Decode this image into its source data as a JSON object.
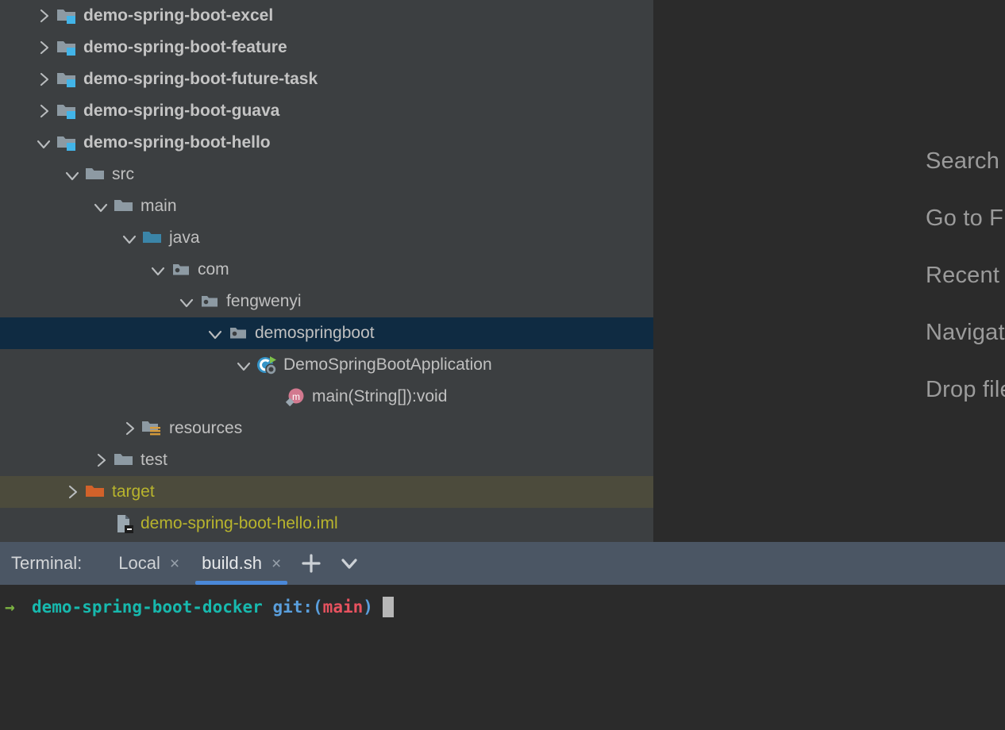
{
  "editor_hints": [
    {
      "text": "Search Everywhere",
      "icon": "search-everywhere-hint"
    },
    {
      "text": "Go to File",
      "icon": "go-to-file-hint"
    },
    {
      "text": "Recent Files",
      "icon": "recent-files-hint"
    },
    {
      "text": "Navigation Bar",
      "icon": "navigation-bar-hint"
    },
    {
      "text": "Drop files here to open them",
      "icon": "drop-files-hint"
    }
  ],
  "project_tree": [
    {
      "id": "demo-spring-boot-excel",
      "label": "demo-spring-boot-excel",
      "indent": 0,
      "chevron": "right",
      "icon": "module-folder-icon",
      "style": "bold",
      "row": "normal"
    },
    {
      "id": "demo-spring-boot-feature",
      "label": "demo-spring-boot-feature",
      "indent": 0,
      "chevron": "right",
      "icon": "module-folder-icon",
      "style": "bold",
      "row": "normal"
    },
    {
      "id": "demo-spring-boot-future-task",
      "label": "demo-spring-boot-future-task",
      "indent": 0,
      "chevron": "right",
      "icon": "module-folder-icon",
      "style": "bold",
      "row": "normal"
    },
    {
      "id": "demo-spring-boot-guava",
      "label": "demo-spring-boot-guava",
      "indent": 0,
      "chevron": "right",
      "icon": "module-folder-icon",
      "style": "bold",
      "row": "normal"
    },
    {
      "id": "demo-spring-boot-hello",
      "label": "demo-spring-boot-hello",
      "indent": 0,
      "chevron": "down",
      "icon": "module-folder-icon",
      "style": "bold",
      "row": "normal"
    },
    {
      "id": "src",
      "label": "src",
      "indent": 1,
      "chevron": "down",
      "icon": "folder-icon",
      "style": "plain",
      "row": "normal"
    },
    {
      "id": "main",
      "label": "main",
      "indent": 2,
      "chevron": "down",
      "icon": "folder-icon",
      "style": "plain",
      "row": "normal"
    },
    {
      "id": "java",
      "label": "java",
      "indent": 3,
      "chevron": "down",
      "icon": "source-folder-icon",
      "style": "plain",
      "row": "normal"
    },
    {
      "id": "com",
      "label": "com",
      "indent": 4,
      "chevron": "down",
      "icon": "package-icon",
      "style": "plain",
      "row": "normal"
    },
    {
      "id": "fengwenyi",
      "label": "fengwenyi",
      "indent": 5,
      "chevron": "down",
      "icon": "package-icon",
      "style": "plain",
      "row": "normal"
    },
    {
      "id": "demospringboot",
      "label": "demospringboot",
      "indent": 6,
      "chevron": "down",
      "icon": "package-icon",
      "style": "plain",
      "row": "selected"
    },
    {
      "id": "DemoSpringBootApplication",
      "label": "DemoSpringBootApplication",
      "indent": 7,
      "chevron": "down",
      "icon": "spring-boot-class-icon",
      "style": "plain",
      "row": "normal"
    },
    {
      "id": "main-method",
      "label": "main(String[]):void",
      "indent": 8,
      "chevron": "none",
      "icon": "method-icon",
      "style": "plain",
      "row": "normal"
    },
    {
      "id": "resources",
      "label": "resources",
      "indent": 3,
      "chevron": "right",
      "icon": "resources-folder-icon",
      "style": "plain",
      "row": "normal"
    },
    {
      "id": "test",
      "label": "test",
      "indent": 2,
      "chevron": "right",
      "icon": "folder-icon",
      "style": "plain",
      "row": "normal"
    },
    {
      "id": "target",
      "label": "target",
      "indent": 1,
      "chevron": "right",
      "icon": "excluded-folder-icon",
      "style": "olive",
      "row": "highlighted"
    },
    {
      "id": "demo-spring-boot-hello.iml",
      "label": "demo-spring-boot-hello.iml",
      "indent": 2,
      "chevron": "none",
      "icon": "iml-file-icon",
      "style": "olive",
      "row": "normal"
    }
  ],
  "terminal": {
    "title": "Terminal:",
    "tabs": [
      {
        "id": "local",
        "label": "Local",
        "close": "×",
        "active": false
      },
      {
        "id": "build-sh",
        "label": "build.sh",
        "close": "×",
        "active": true
      }
    ],
    "add_button": "add-tab-button",
    "options_button": "tab-options-button",
    "prompt": {
      "arrow": "→",
      "directory": "demo-spring-boot-docker",
      "git_prefix": "git:(",
      "branch": "main",
      "git_suffix": ")"
    }
  },
  "colors": {
    "panel_bg": "#3c3f41",
    "editor_bg": "#2b2b2b",
    "selection": "#0f2b42",
    "excluded_highlight": "#4c4b3c",
    "terminal_tabbar": "#4b5664",
    "active_tab_underline": "#4a88d8",
    "module_badge": "#42b4e8",
    "source_folder": "#3b85a8",
    "excluded_folder": "#d2622a",
    "olive_text": "#b8b42d",
    "prompt_arrow": "#7cb342",
    "prompt_dir": "#17b9ae",
    "prompt_git": "#5a9fdd",
    "prompt_branch": "#e8525f"
  }
}
